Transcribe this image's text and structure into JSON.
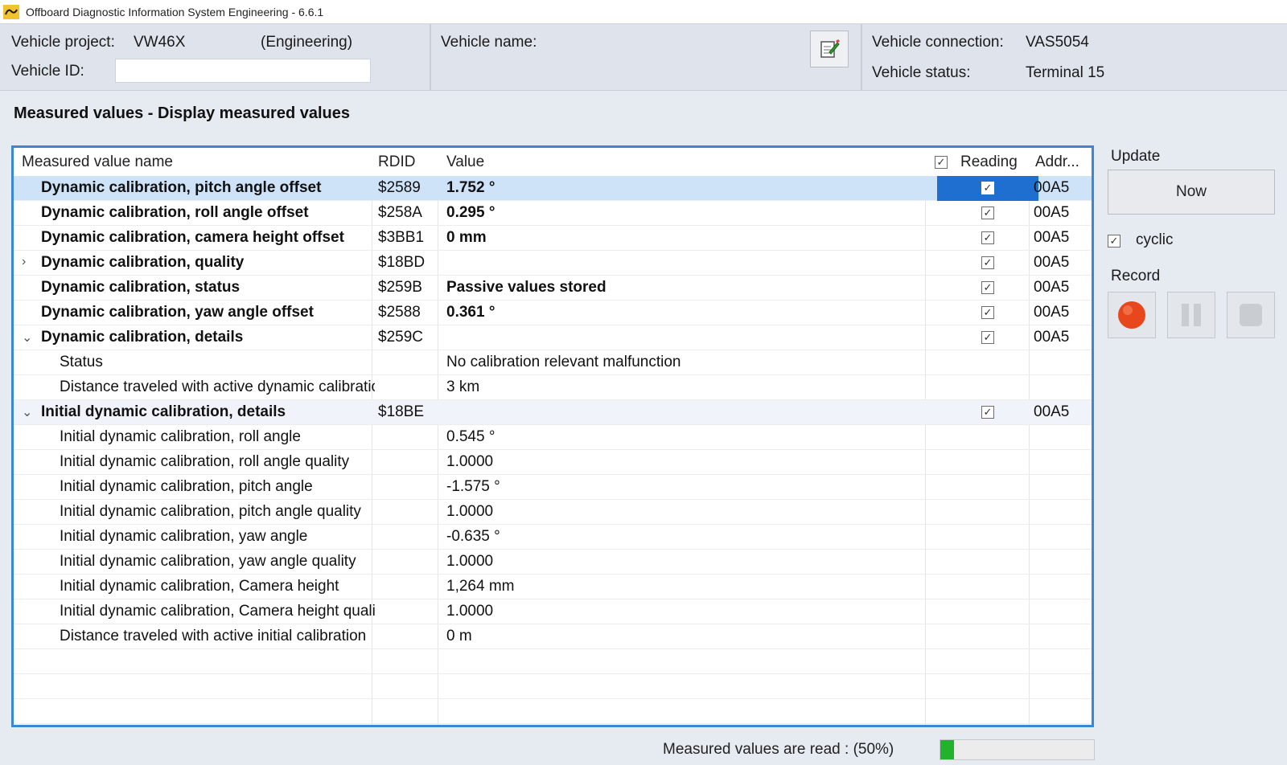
{
  "window": {
    "title": "Offboard Diagnostic Information System Engineering - 6.6.1"
  },
  "header": {
    "vehicle_project_label": "Vehicle project:",
    "vehicle_project_value": "VW46X",
    "vehicle_project_mode": "(Engineering)",
    "vehicle_id_label": "Vehicle ID:",
    "vehicle_id_value": "",
    "vehicle_name_label": "Vehicle name:",
    "vehicle_connection_label": "Vehicle connection:",
    "vehicle_connection_value": "VAS5054",
    "vehicle_status_label": "Vehicle status:",
    "vehicle_status_value": "Terminal 15"
  },
  "page_heading": "Measured values - Display measured values",
  "table": {
    "columns": {
      "name": "Measured value name",
      "rdid": "RDID",
      "value": "Value",
      "reading": "Reading",
      "addr": "Addr..."
    },
    "rows": [
      {
        "name": "Dynamic calibration, pitch angle offset",
        "rdid": "$2589",
        "value": "1.752 °",
        "checked": "✓",
        "addr": "00A5"
      },
      {
        "name": "Dynamic calibration, roll angle offset",
        "rdid": "$258A",
        "value": "0.295 °",
        "checked": "✓",
        "addr": "00A5"
      },
      {
        "name": "Dynamic calibration, camera height offset",
        "rdid": "$3BB1",
        "value": "0 mm",
        "checked": "✓",
        "addr": "00A5"
      },
      {
        "name": "Dynamic calibration, quality",
        "rdid": "$18BD",
        "value": "",
        "checked": "✓",
        "addr": "00A5",
        "expander": "›"
      },
      {
        "name": "Dynamic calibration, status",
        "rdid": "$259B",
        "value": "Passive values stored",
        "checked": "✓",
        "addr": "00A5"
      },
      {
        "name": "Dynamic calibration, yaw angle offset",
        "rdid": "$2588",
        "value": "0.361 °",
        "checked": "✓",
        "addr": "00A5"
      },
      {
        "name": "Dynamic calibration, details",
        "rdid": "$259C",
        "value": "",
        "checked": "✓",
        "addr": "00A5",
        "expander": "⌄"
      },
      {
        "name": "Status",
        "value": "No calibration relevant malfunction"
      },
      {
        "name": "Distance traveled with active dynamic calibration",
        "value": "3 km"
      },
      {
        "name": "Initial dynamic calibration, details",
        "rdid": "$18BE",
        "value": "",
        "checked": "✓",
        "addr": "00A5",
        "expander": "⌄"
      },
      {
        "name": "Initial dynamic calibration, roll angle",
        "value": "0.545 °"
      },
      {
        "name": "Initial dynamic calibration, roll angle quality",
        "value": "1.0000"
      },
      {
        "name": "Initial dynamic calibration, pitch angle",
        "value": "-1.575 °"
      },
      {
        "name": "Initial dynamic calibration, pitch angle quality",
        "value": "1.0000"
      },
      {
        "name": "Initial dynamic calibration, yaw angle",
        "value": "-0.635 °"
      },
      {
        "name": "Initial dynamic calibration, yaw angle quality",
        "value": "1.0000"
      },
      {
        "name": "Initial dynamic calibration, Camera height",
        "value": "1,264 mm"
      },
      {
        "name": "Initial dynamic calibration, Camera height quality",
        "value": "1.0000"
      },
      {
        "name": "Distance traveled with active initial calibration",
        "value": "0 m"
      }
    ]
  },
  "right_panel": {
    "update_label": "Update",
    "now_button": "Now",
    "cyclic_label": "cyclic",
    "cyclic_check": "✓",
    "record_label": "Record"
  },
  "status": {
    "text": "Measured values are read : (50%)",
    "progress": 0.09
  },
  "colors": {
    "accent": "#3a87d6",
    "selection": "#1e6fcf",
    "progress": "#22b22b",
    "record": "#e8461c"
  }
}
